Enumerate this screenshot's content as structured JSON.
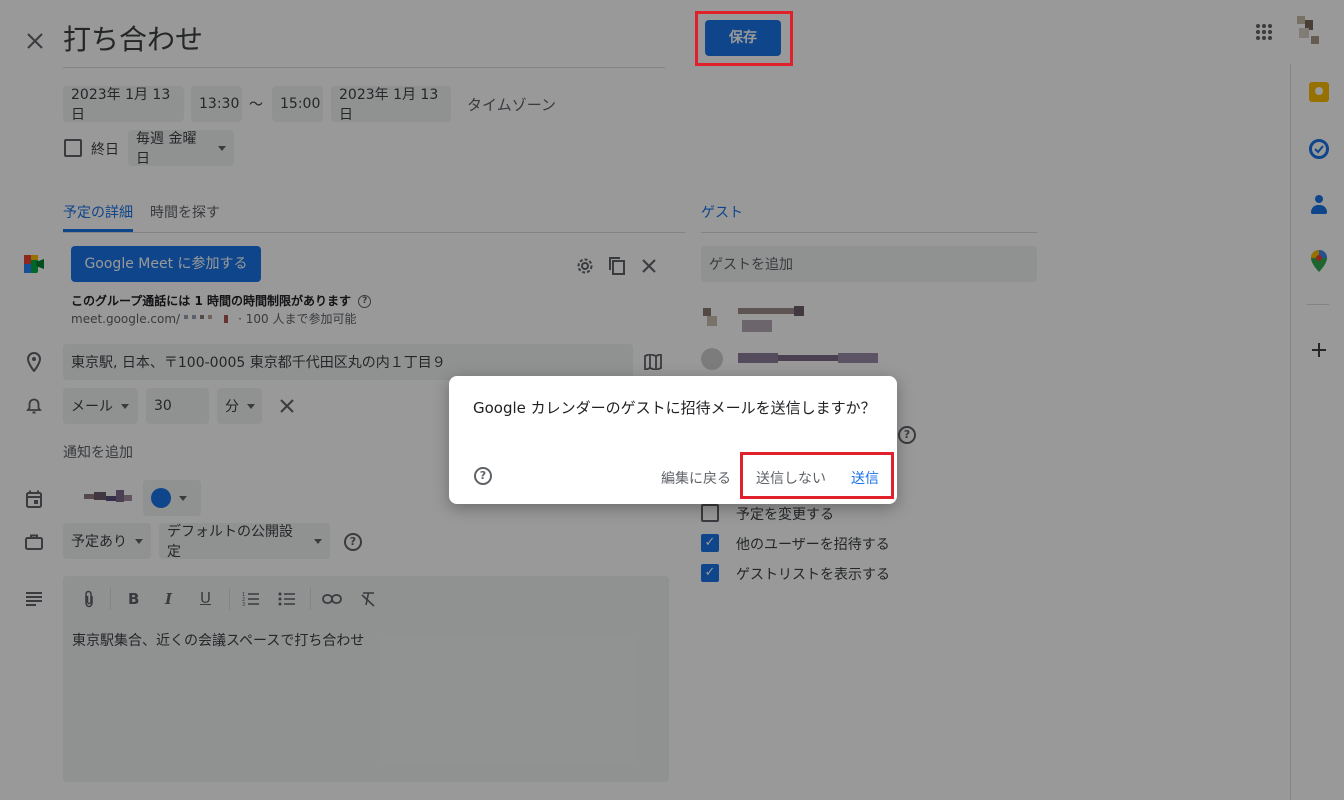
{
  "header": {
    "title": "打ち合わせ",
    "save_label": "保存"
  },
  "datetime": {
    "start_date": "2023年 1月 13日",
    "start_time": "13:30",
    "separator": "～",
    "end_time": "15:00",
    "end_date": "2023年 1月 13日",
    "timezone_label": "タイムゾーン",
    "all_day_label": "終日",
    "repeat_label": "毎週 金曜日"
  },
  "tabs": {
    "details": "予定の詳細",
    "find_time": "時間を探す",
    "guests": "ゲスト"
  },
  "meet": {
    "join_label": "Google Meet に参加する",
    "limit_notice": "このグループ通話には 1 時間の時間制限があります",
    "link_prefix": "meet.google.com/",
    "capacity": "· 100 人まで参加可能"
  },
  "location": {
    "value": "東京駅, 日本、〒100-0005 東京都千代田区丸の内１丁目９"
  },
  "notification": {
    "method": "メール",
    "amount": "30",
    "unit": "分",
    "add_label": "通知を追加"
  },
  "status": {
    "availability": "予定あり",
    "visibility": "デフォルトの公開設定"
  },
  "description": {
    "text": "東京駅集合、近くの会議スペースで打ち合わせ",
    "toolbar": {
      "bold": "B",
      "italic": "I",
      "underline": "U"
    }
  },
  "guests": {
    "add_placeholder": "ゲストを追加",
    "permissions": [
      {
        "label": "予定を変更する",
        "checked": false
      },
      {
        "label": "他のユーザーを招待する",
        "checked": true
      },
      {
        "label": "ゲストリストを表示する",
        "checked": true
      }
    ]
  },
  "dialog": {
    "message": "Google カレンダーのゲストに招待メールを送信しますか？",
    "back_label": "編集に戻る",
    "dont_send_label": "送信しない",
    "send_label": "送信"
  },
  "colors": {
    "accent": "#1a73e8",
    "primary_button": "#1a73e8",
    "highlight_box": "#e0202a",
    "calendar_color": "#1a73e8"
  },
  "icons": [
    "close-icon",
    "apps-grid-icon",
    "keep-icon",
    "tasks-icon",
    "contacts-icon",
    "maps-icon",
    "add-icon",
    "settings-icon",
    "copy-icon",
    "location-pin-icon",
    "map-icon",
    "bell-icon",
    "calendar-icon",
    "briefcase-icon",
    "notes-icon",
    "help-icon",
    "attach-icon",
    "link-icon",
    "clear-format-icon",
    "numbered-list-icon",
    "bulleted-list-icon"
  ]
}
